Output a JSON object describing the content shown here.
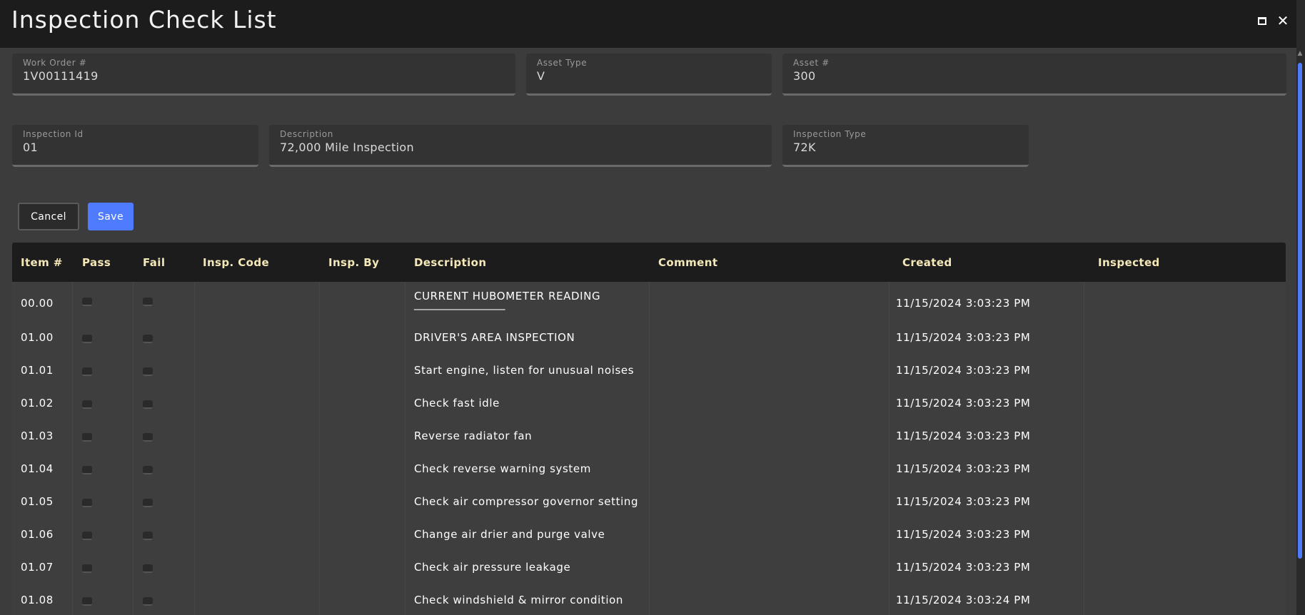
{
  "window": {
    "title": "Inspection Check List",
    "maximize_icon": "maximize-icon",
    "close_icon": "close-icon",
    "close_glyph": "✕"
  },
  "form": {
    "work_order": {
      "label": "Work Order #",
      "value": "1V00111419"
    },
    "asset_type": {
      "label": "Asset Type",
      "value": "V"
    },
    "asset_number": {
      "label": "Asset #",
      "value": "300"
    },
    "inspection_id": {
      "label": "Inspection Id",
      "value": "01"
    },
    "description": {
      "label": "Description",
      "value": "72,000 Mile Inspection"
    },
    "inspection_type": {
      "label": "Inspection Type",
      "value": "72K"
    }
  },
  "actions": {
    "cancel_label": "Cancel",
    "save_label": "Save"
  },
  "colors": {
    "accent": "#4f7cff",
    "header_text": "#f4e8b8",
    "background": "#3c3c3c",
    "titlebar": "#1c1c1c"
  },
  "table": {
    "columns": [
      "Item #",
      "Pass",
      "Fail",
      "Insp. Code",
      "Insp. By",
      "Description",
      "Comment",
      "Created",
      "Inspected"
    ],
    "rows": [
      {
        "item": "00.00",
        "description": "CURRENT HUBOMETER READING",
        "description_line2": "_________________",
        "created": "11/15/2024 3:03:23 PM"
      },
      {
        "item": "01.00",
        "description": "DRIVER'S AREA INSPECTION",
        "created": "11/15/2024 3:03:23 PM"
      },
      {
        "item": "01.01",
        "description": "Start engine, listen for unusual noises",
        "created": "11/15/2024 3:03:23 PM"
      },
      {
        "item": "01.02",
        "description": "Check fast idle",
        "created": "11/15/2024 3:03:23 PM"
      },
      {
        "item": "01.03",
        "description": "Reverse radiator fan",
        "created": "11/15/2024 3:03:23 PM"
      },
      {
        "item": "01.04",
        "description": "Check reverse warning system",
        "created": "11/15/2024 3:03:23 PM"
      },
      {
        "item": "01.05",
        "description": "Check air compressor governor setting",
        "created": "11/15/2024 3:03:23 PM"
      },
      {
        "item": "01.06",
        "description": "Change air drier and purge valve",
        "created": "11/15/2024 3:03:23 PM"
      },
      {
        "item": "01.07",
        "description": "Check air pressure leakage",
        "created": "11/15/2024 3:03:23 PM"
      },
      {
        "item": "01.08",
        "description": "Check windshield & mirror condition",
        "created": "11/15/2024 3:03:24 PM"
      }
    ]
  }
}
